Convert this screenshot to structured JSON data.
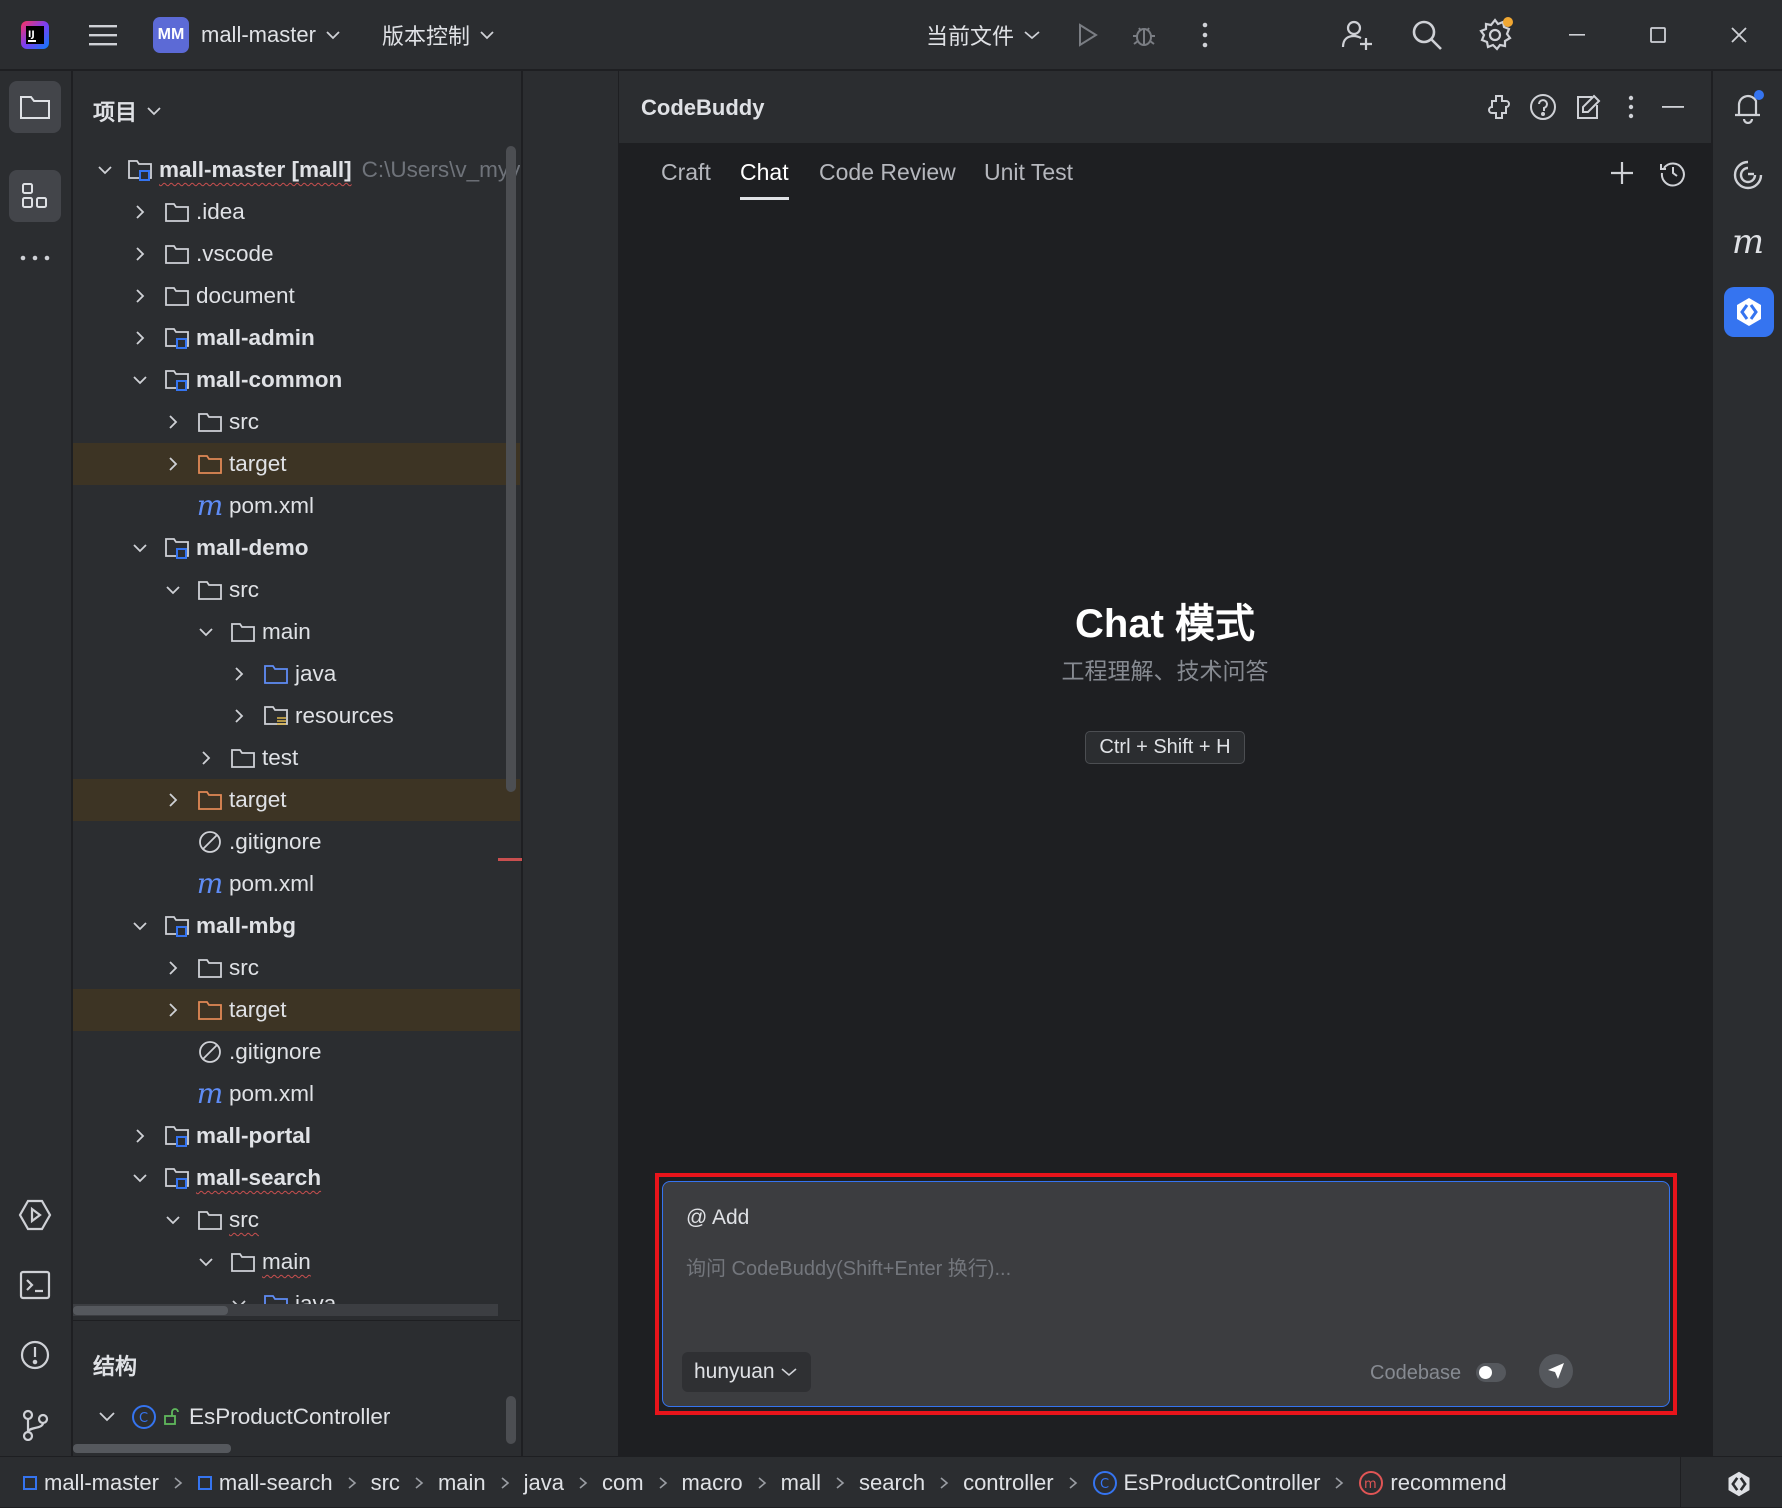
{
  "titlebar": {
    "project_badge": "MM",
    "project_name": "mall-master",
    "vcs_label": "版本控制",
    "run_config": "当前文件"
  },
  "project_panel": {
    "title": "项目",
    "structure_title": "结构",
    "structure_item": "EsProductController",
    "tree": [
      {
        "label": "mall-master [mall]",
        "path": "C:\\Users\\v_myy",
        "depth": 0,
        "expanded": true,
        "icon": "module-folder-icon",
        "bold": true,
        "squiggle": true
      },
      {
        "label": ".idea",
        "depth": 1,
        "expanded": false,
        "icon": "folder-icon"
      },
      {
        "label": ".vscode",
        "depth": 1,
        "expanded": false,
        "icon": "folder-icon"
      },
      {
        "label": "document",
        "depth": 1,
        "expanded": false,
        "icon": "folder-icon"
      },
      {
        "label": "mall-admin",
        "depth": 1,
        "expanded": false,
        "icon": "module-folder-icon",
        "bold": true
      },
      {
        "label": "mall-common",
        "depth": 1,
        "expanded": true,
        "icon": "module-folder-icon",
        "bold": true
      },
      {
        "label": "src",
        "depth": 2,
        "expanded": false,
        "icon": "folder-icon"
      },
      {
        "label": "target",
        "depth": 2,
        "expanded": false,
        "icon": "excluded-folder-icon",
        "highlight": true
      },
      {
        "label": "pom.xml",
        "depth": 2,
        "icon": "maven-icon"
      },
      {
        "label": "mall-demo",
        "depth": 1,
        "expanded": true,
        "icon": "module-folder-icon",
        "bold": true
      },
      {
        "label": "src",
        "depth": 2,
        "expanded": true,
        "icon": "folder-icon"
      },
      {
        "label": "main",
        "depth": 3,
        "expanded": true,
        "icon": "folder-icon"
      },
      {
        "label": "java",
        "depth": 4,
        "expanded": false,
        "icon": "source-folder-icon"
      },
      {
        "label": "resources",
        "depth": 4,
        "expanded": false,
        "icon": "resources-folder-icon"
      },
      {
        "label": "test",
        "depth": 3,
        "expanded": false,
        "icon": "folder-icon"
      },
      {
        "label": "target",
        "depth": 2,
        "expanded": false,
        "icon": "excluded-folder-icon",
        "highlight": true
      },
      {
        "label": ".gitignore",
        "depth": 2,
        "icon": "ignore-file-icon"
      },
      {
        "label": "pom.xml",
        "depth": 2,
        "icon": "maven-icon"
      },
      {
        "label": "mall-mbg",
        "depth": 1,
        "expanded": true,
        "icon": "module-folder-icon",
        "bold": true
      },
      {
        "label": "src",
        "depth": 2,
        "expanded": false,
        "icon": "folder-icon"
      },
      {
        "label": "target",
        "depth": 2,
        "expanded": false,
        "icon": "excluded-folder-icon",
        "highlight": true
      },
      {
        "label": ".gitignore",
        "depth": 2,
        "icon": "ignore-file-icon"
      },
      {
        "label": "pom.xml",
        "depth": 2,
        "icon": "maven-icon"
      },
      {
        "label": "mall-portal",
        "depth": 1,
        "expanded": false,
        "icon": "module-folder-icon",
        "bold": true
      },
      {
        "label": "mall-search",
        "depth": 1,
        "expanded": true,
        "icon": "module-folder-icon",
        "bold": true,
        "squiggle": true
      },
      {
        "label": "src",
        "depth": 2,
        "expanded": true,
        "icon": "folder-icon",
        "squiggle": true
      },
      {
        "label": "main",
        "depth": 3,
        "expanded": true,
        "icon": "folder-icon",
        "squiggle": true
      },
      {
        "label": "java",
        "depth": 4,
        "expanded": true,
        "icon": "source-folder-icon"
      }
    ]
  },
  "codebuddy": {
    "title": "CodeBuddy",
    "tabs": [
      {
        "label": "Craft",
        "active": false
      },
      {
        "label": "Chat",
        "active": true
      },
      {
        "label": "Code Review",
        "active": false
      },
      {
        "label": "Unit Test",
        "active": false
      }
    ],
    "hero_title": "Chat 模式",
    "hero_subtitle": "工程理解、技术问答",
    "shortcut": "Ctrl + Shift + H",
    "input": {
      "add_label": "@ Add",
      "placeholder": "询问 CodeBuddy(Shift+Enter 换行)...",
      "model": "hunyuan",
      "codebase_label": "Codebase",
      "codebase_enabled": false
    },
    "highlight_color": "#e8141b"
  },
  "statusbar": {
    "breadcrumbs": [
      "mall-master",
      "mall-search",
      "src",
      "main",
      "java",
      "com",
      "macro",
      "mall",
      "search",
      "controller",
      "EsProductController",
      "recommend"
    ]
  },
  "colors": {
    "accent": "#3574f0",
    "folder_excluded": "#e08855",
    "maven": "#5f8cf5",
    "notification_dot": "#f0a732"
  }
}
